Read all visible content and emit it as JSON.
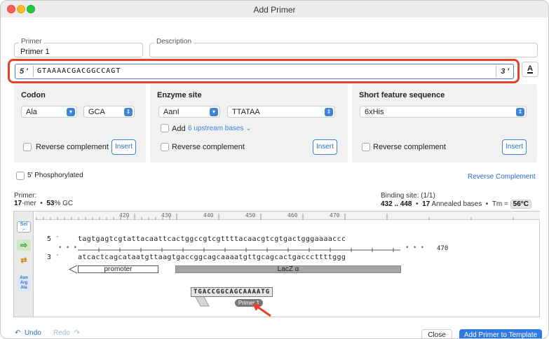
{
  "window": {
    "title": "Add Primer"
  },
  "primer": {
    "legend": "Primer",
    "value": "Primer 1"
  },
  "description": {
    "legend": "Description",
    "value": ""
  },
  "sequence": {
    "five": "5 ′",
    "value": "GTAAAACGACGGCCAGT",
    "three": "3 ′",
    "font_button": "A"
  },
  "codon": {
    "title": "Codon",
    "amino_acid": "Ala",
    "codon": "GCA",
    "reverse_label": "Reverse complement",
    "insert_label": "Insert"
  },
  "enzyme": {
    "title": "Enzyme site",
    "enzyme": "AanI",
    "site": "TTATAA",
    "add_label": "Add",
    "upstream_label": "6 upstream bases",
    "reverse_label": "Reverse complement",
    "insert_label": "Insert"
  },
  "short_feature": {
    "title": "Short feature sequence",
    "value": "6xHis",
    "reverse_label": "Reverse complement",
    "insert_label": "Insert"
  },
  "phosphorylated_label": "5′ Phosphorylated",
  "reverse_complement_link": "Reverse Complement",
  "stats": {
    "primer_label": "Primer:",
    "length": "17",
    "length_unit": "-mer",
    "gc": "53",
    "gc_unit": "% GC",
    "binding_label": "Binding site: (1/1)",
    "binding_range": "432 .. 448",
    "annealed": "17",
    "annealed_label": "Annealed bases",
    "tm_label": "Tm =",
    "tm_value": "56°C"
  },
  "viewer": {
    "ruler_ticks": [
      "420",
      "430",
      "440",
      "450",
      "460",
      "470"
    ],
    "top_strand_label": "5 ′",
    "bottom_strand_label": "3 ′",
    "top_strand": "tagtgagtcgtattacaattcactggccgtcgttttacaacgtcgtgactgggaaaaccc",
    "bottom_strand": "atcactcagcataatgttaagtgaccggcagcaaaatgttgcagcactgacccttttggg",
    "position_label": "470",
    "features": {
      "promoter": "promoter",
      "lacz": "LacZ α"
    },
    "primer_bind": "TGACCGGCAGCAAAATG",
    "primer_name": "Primer 1",
    "tools": {
      "sel": "Sel",
      "aa": "Asn Arg Ala"
    }
  },
  "footer": {
    "undo": "Undo",
    "redo": "Redo",
    "close": "Close",
    "add": "Add Primer to Template"
  }
}
